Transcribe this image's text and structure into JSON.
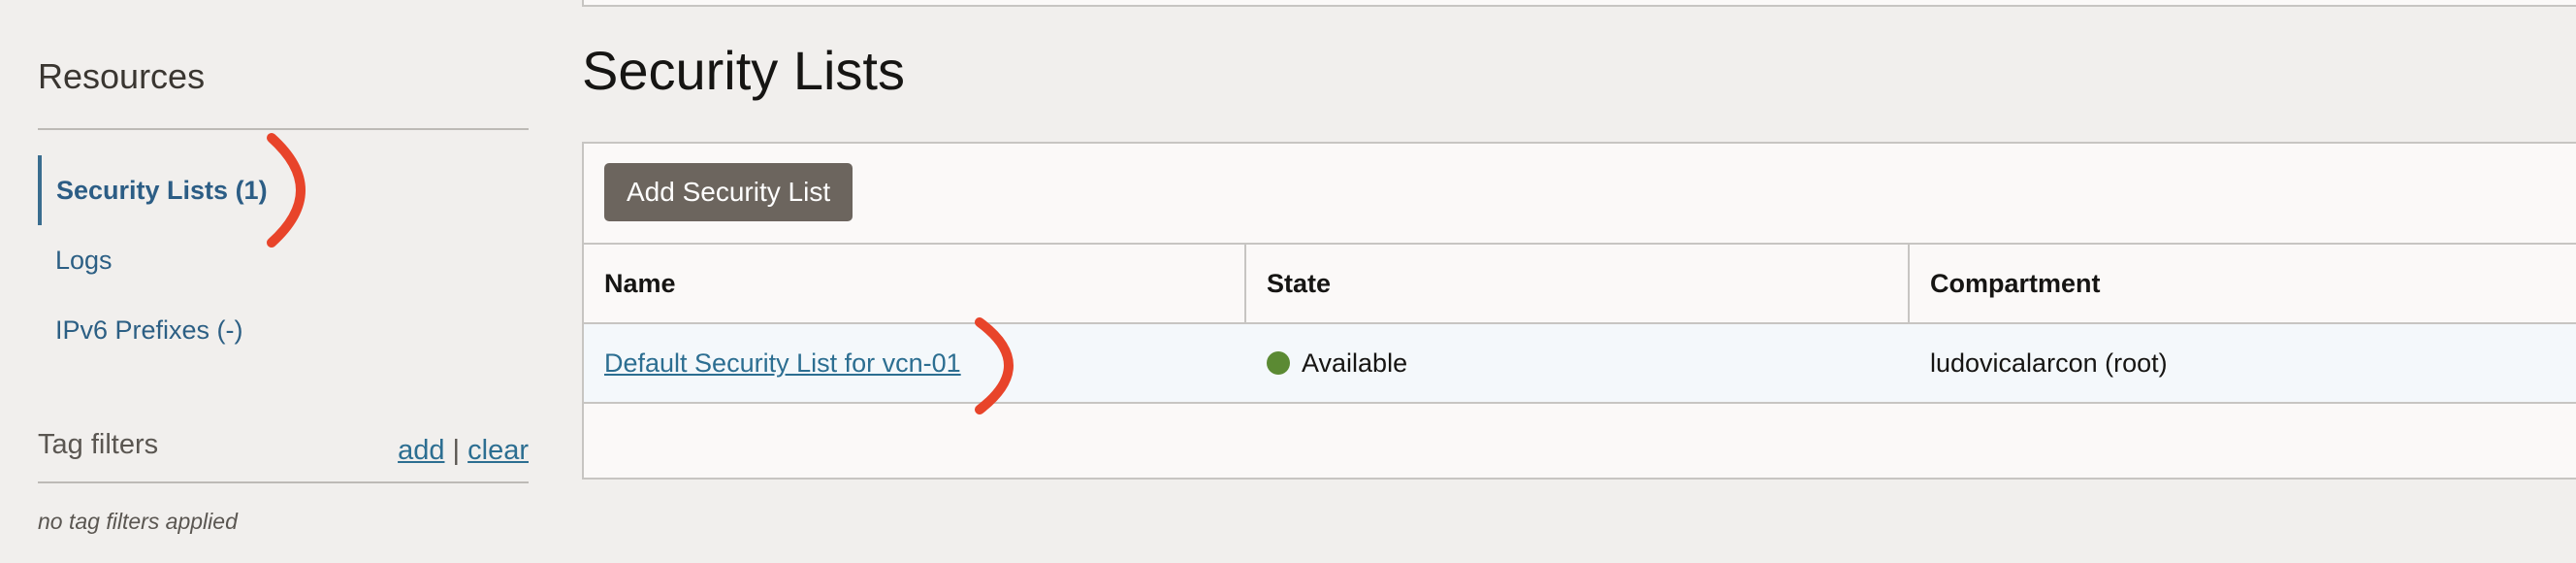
{
  "sidebar": {
    "title": "Resources",
    "items": [
      {
        "label": "Security Lists (1)"
      },
      {
        "label": "Logs"
      },
      {
        "label": "IPv6 Prefixes (-)"
      }
    ],
    "tag_filters": {
      "title": "Tag filters",
      "add_label": "add",
      "separator": "|",
      "clear_label": "clear",
      "empty_text": "no tag filters applied"
    }
  },
  "main": {
    "title": "Security Lists",
    "add_button_label": "Add Security List",
    "table": {
      "columns": [
        "Name",
        "State",
        "Compartment"
      ],
      "rows": [
        {
          "name": "Default Security List for vcn-01",
          "state": "Available",
          "compartment": "ludovicalarcon (root)"
        }
      ]
    }
  },
  "colors": {
    "annotation": "#e8442a",
    "available": "#5b8a33",
    "link": "#2c6e91"
  }
}
